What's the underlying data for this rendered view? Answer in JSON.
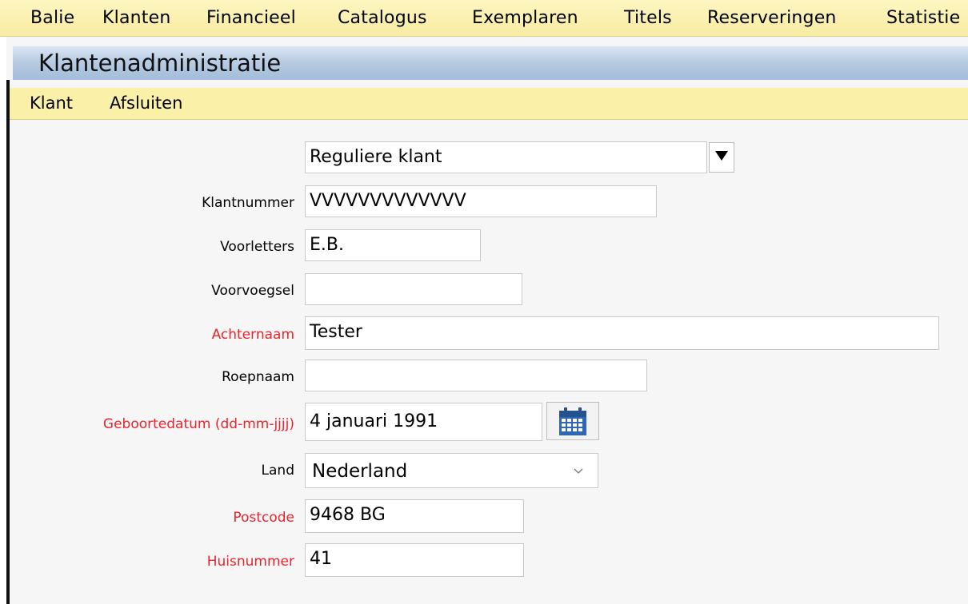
{
  "main_menu": {
    "items": [
      "Balie",
      "Klanten",
      "Financieel",
      "Catalogus",
      "Exemplaren",
      "Titels",
      "Reserveringen",
      "Statistie"
    ]
  },
  "window": {
    "title": "Klantenadministratie"
  },
  "sub_menu": {
    "items": [
      "Klant",
      "Afsluiten"
    ]
  },
  "form": {
    "klant_type": {
      "value": "Reguliere klant"
    },
    "klantnummer": {
      "label": "Klantnummer",
      "value": "VVVVVVVVVVVVV",
      "required": false
    },
    "voorletters": {
      "label": "Voorletters",
      "value": "E.B.",
      "required": false
    },
    "voorvoegsel": {
      "label": "Voorvoegsel",
      "value": "",
      "required": false
    },
    "achternaam": {
      "label": "Achternaam",
      "value": "Tester",
      "required": true
    },
    "roepnaam": {
      "label": "Roepnaam",
      "value": "",
      "required": false
    },
    "geboortedatum": {
      "label": "Geboortedatum (dd-mm-jjjj)",
      "value": "4 januari 1991",
      "required": true
    },
    "land": {
      "label": "Land",
      "value": "Nederland",
      "required": false
    },
    "postcode": {
      "label": "Postcode",
      "value": "9468 BG",
      "required": true
    },
    "huisnummer": {
      "label": "Huisnummer",
      "value": "41",
      "required": true
    }
  },
  "colors": {
    "menu_bg": "#f7eca2",
    "title_bar_bg": "#b8cce3",
    "required_label": "#e8242c",
    "calendar_icon": "#2f67b7"
  },
  "icons": {
    "dropdown": "triangle-down-icon",
    "calendar": "calendar-icon",
    "select_chevron": "chevron-down-icon"
  }
}
